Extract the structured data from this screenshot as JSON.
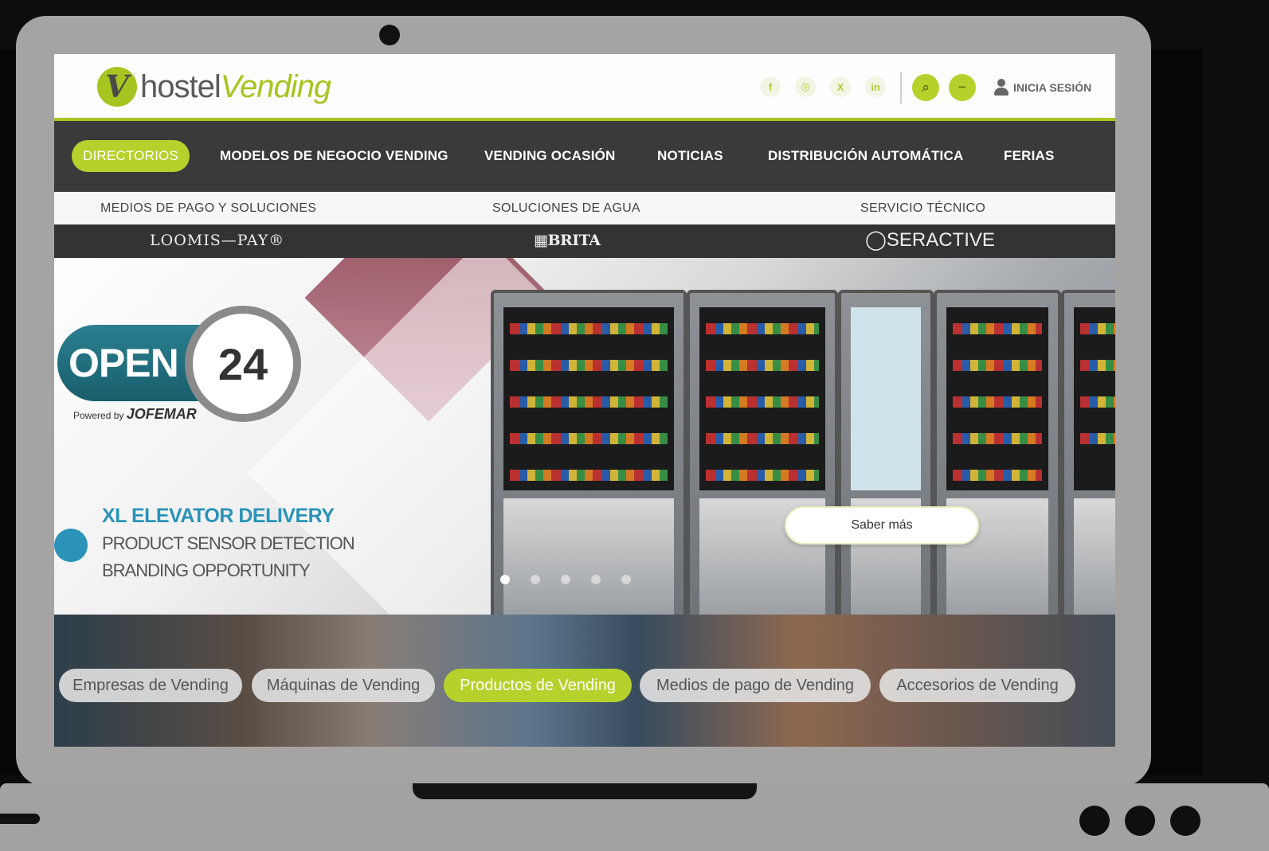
{
  "header": {
    "logo_mark": "V",
    "logo_part1": "hostel",
    "logo_part2": "Vending",
    "social": [
      {
        "name": "facebook-icon",
        "glyph": "f"
      },
      {
        "name": "instagram-icon",
        "glyph": "◎"
      },
      {
        "name": "x-icon",
        "glyph": "X"
      },
      {
        "name": "linkedin-icon",
        "glyph": "in"
      }
    ],
    "search_glyph": "⌕",
    "newsletter_glyph": "−",
    "login_label": "INICIA SESIÓN"
  },
  "nav": {
    "items": [
      "DIRECTORIOS",
      "MODELOS DE NEGOCIO VENDING",
      "VENDING OCASIÓN",
      "NOTICIAS",
      "DISTRIBUCIÓN AUTOMÁTICA",
      "FERIAS"
    ],
    "active_index": 0
  },
  "subnav": {
    "items": [
      "MEDIOS DE PAGO Y SOLUCIONES",
      "SOLUCIONES DE AGUA",
      "SERVICIO TÉCNICO"
    ]
  },
  "sponsors": [
    "LOOMIS—PAY®",
    "▦BRITA",
    "◯SERACTIVE"
  ],
  "hero": {
    "open_label": "OPEN",
    "number": "24",
    "powered_by": "Powered by",
    "brand": "JOFEMAR",
    "features": [
      "XL ELEVATOR DELIVERY",
      "PRODUCT SENSOR DETECTION",
      "BRANDING OPPORTUNITY"
    ],
    "cta_label": "Saber más",
    "slide_count": 5,
    "active_slide": 0
  },
  "categories": {
    "items": [
      "Empresas de Vending",
      "Máquinas de Vending",
      "Productos de Vending",
      "Medios de pago de Vending",
      "Accesorios de Vending"
    ],
    "active_index": 2
  },
  "colors": {
    "accent": "#b7d12c",
    "nav_bg": "#3a3a3a",
    "hero_blue": "#2993b8"
  }
}
